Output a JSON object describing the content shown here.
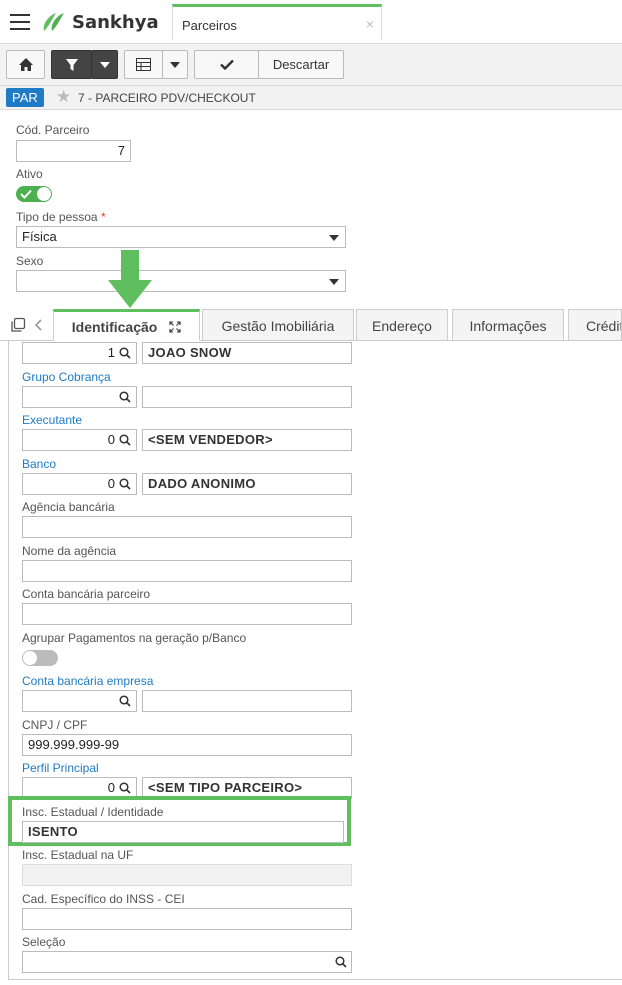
{
  "app": {
    "brand": "Sankhya",
    "tab_title": "Parceiros",
    "tab_close": "×"
  },
  "toolbar": {
    "discard_label": "Descartar"
  },
  "breadcrumb": {
    "badge": "PAR",
    "title": "7 - PARCEIRO PDV/CHECKOUT"
  },
  "header_form": {
    "cod_parceiro_label": "Cód. Parceiro",
    "cod_parceiro_value": "7",
    "ativo_label": "Ativo",
    "ativo_value": true,
    "tipo_pessoa_label": "Tipo de pessoa",
    "tipo_pessoa_required": "*",
    "tipo_pessoa_value": "Física",
    "sexo_label": "Sexo",
    "sexo_value": ""
  },
  "tabs": [
    {
      "label": "Identificação",
      "active": true
    },
    {
      "label": "Gestão Imobiliária"
    },
    {
      "label": "Endereço"
    },
    {
      "label": "Informações"
    },
    {
      "label": "Crédit"
    }
  ],
  "identificacao": {
    "row1": {
      "code": "1",
      "desc": "JOAO SNOW"
    },
    "grupo_cobranca": {
      "label": "Grupo Cobrança",
      "code": "",
      "desc": ""
    },
    "executante": {
      "label": "Executante",
      "code": "0",
      "desc": "<SEM VENDEDOR>"
    },
    "banco": {
      "label": "Banco",
      "code": "0",
      "desc": "DADO ANONIMO"
    },
    "agencia_bancaria": {
      "label": "Agência bancária",
      "value": ""
    },
    "nome_agencia": {
      "label": "Nome da agência",
      "value": ""
    },
    "conta_bancaria_parceiro": {
      "label": "Conta bancária parceiro",
      "value": ""
    },
    "agrupar_pagamentos": {
      "label": "Agrupar Pagamentos na geração p/Banco",
      "value": false
    },
    "conta_bancaria_empresa": {
      "label": "Conta bancária empresa",
      "code": "",
      "desc": ""
    },
    "cnpj_cpf": {
      "label": "CNPJ / CPF",
      "value": "999.999.999-99"
    },
    "perfil_principal": {
      "label": "Perfil Principal",
      "code": "0",
      "desc": "<SEM TIPO PARCEIRO>"
    },
    "insc_estadual": {
      "label": "Insc. Estadual / Identidade",
      "value": "ISENTO"
    },
    "insc_estadual_uf": {
      "label": "Insc. Estadual na UF",
      "value": ""
    },
    "cad_inss": {
      "label": "Cad. Específico do INSS - CEI",
      "value": ""
    },
    "selecao": {
      "label": "Seleção",
      "value": ""
    }
  },
  "colors": {
    "accent_green": "#5fbf5f",
    "brand_blue": "#1f7bc6",
    "toggle_on": "#4caf50",
    "toggle_off": "#bbbbbb"
  }
}
